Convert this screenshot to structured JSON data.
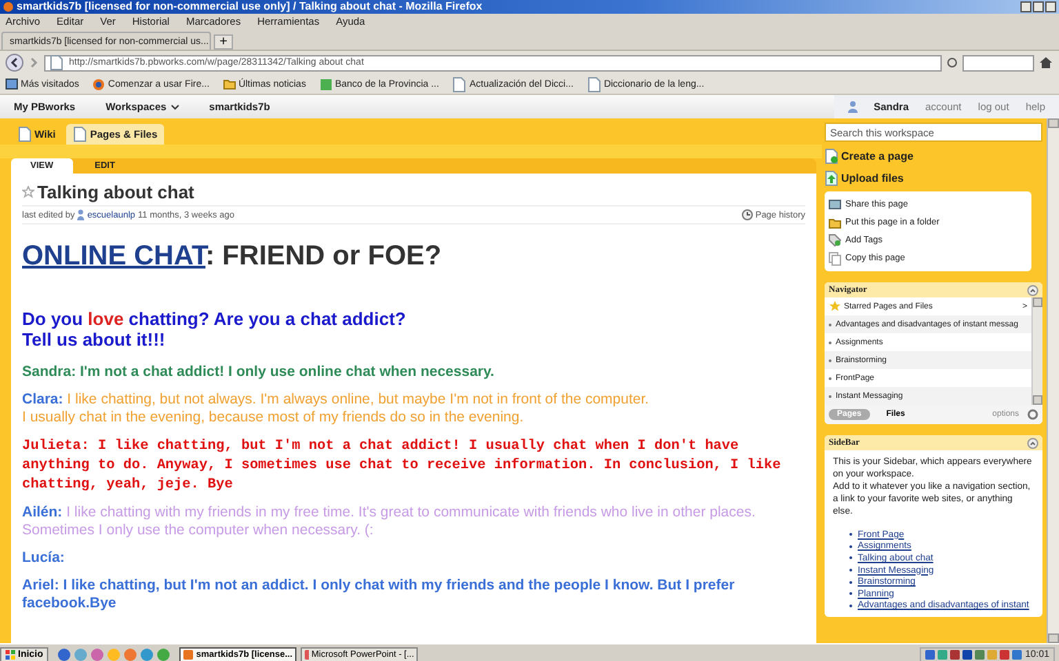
{
  "browser": {
    "title": "smartkids7b [licensed for non-commercial use only] / Talking about chat - Mozilla Firefox",
    "menu": [
      "Archivo",
      "Editar",
      "Ver",
      "Historial",
      "Marcadores",
      "Herramientas",
      "Ayuda"
    ],
    "tabs": [
      {
        "label": "smartkids7b [licensed for non-commercial us...",
        "selected": true
      }
    ],
    "new_tab": "+",
    "url": "http://smartkids7b.pbworks.com/w/page/28311342/Talking about chat",
    "bookmarks": [
      {
        "label": "Más visitados",
        "kind": "special"
      },
      {
        "label": "Comenzar a usar Fire...",
        "kind": "browser"
      },
      {
        "label": "Últimas noticias",
        "kind": "folder"
      },
      {
        "label": "Banco de la Provincia ...",
        "kind": "app"
      },
      {
        "label": "Actualización del Dicci...",
        "kind": "page"
      },
      {
        "label": "Diccionario de la leng...",
        "kind": "page"
      }
    ]
  },
  "pbworks_bar": {
    "items": [
      {
        "label": "My PBworks",
        "dropdown": false
      },
      {
        "label": "Workspaces",
        "dropdown": true
      },
      {
        "label": "smartkids7b",
        "dropdown": false
      }
    ],
    "user": "Sandra",
    "links": [
      "account",
      "log out",
      "help"
    ]
  },
  "wiki_tabs": [
    {
      "label": "Wiki",
      "selected": false
    },
    {
      "label": "Pages & Files",
      "selected": true
    }
  ],
  "view_tabs": [
    {
      "label": "VIEW",
      "selected": true
    },
    {
      "label": "EDIT",
      "selected": false
    }
  ],
  "page": {
    "title": "Talking about chat",
    "meta": {
      "prefix": "last edited by",
      "user": "escuelaunlp",
      "time": "11 months, 3 weeks ago"
    },
    "history": "Page history",
    "heading": [
      {
        "text": "ONLINE CHAT",
        "kind": "link"
      },
      {
        "text": ": FRIEND or FOE?",
        "kind": "plain"
      }
    ],
    "question": [
      [
        {
          "text": "Do you ",
          "color": "#1a1acc"
        },
        {
          "text": "love",
          "color": "#dd2222"
        },
        {
          "text": " chatting? Are you a chat addict?",
          "color": "#1a1acc"
        }
      ],
      [
        {
          "text": "Tell us about it!!!",
          "color": "#1a1acc"
        }
      ]
    ],
    "paragraphs": [
      {
        "lines": [
          [
            {
              "text": "Sandra: I'm not a chat addict! I only use online chat when necessary.",
              "color": "#2e8b57",
              "kind": "bold"
            }
          ]
        ]
      },
      {
        "lines": [
          [
            {
              "text": "Clara:",
              "color": "#3a6fd8",
              "kind": "bold"
            },
            {
              "text": " I like chatting, but not always. I'm always online, but maybe I'm not in front of the computer.",
              "color": "#f0a030",
              "kind": "plain"
            }
          ],
          [
            {
              "text": "I usually chat in the evening, because most of my friends do so in the evening.",
              "color": "#f0a030",
              "kind": "plain"
            }
          ]
        ]
      },
      {
        "lines": [
          [
            {
              "text": "Julieta: I like chatting, but I'm not a chat addict! I usually chat when I don't have anything to do. Anyway, I sometimes use chat to receive information. In conclusion, I like chatting, yeah, jeje. Bye",
              "color": "#e01010",
              "kind": "mono"
            }
          ]
        ]
      },
      {
        "lines": [
          [
            {
              "text": "Ailén:",
              "color": "#3a6fd8",
              "kind": "bold"
            },
            {
              "text": " I like chatting with my friends in my free time. It's great to communicate with friends who live in other places. Sometimes I only use the computer when necessary. (:",
              "color": "#c79ae6",
              "kind": "plain"
            }
          ]
        ]
      },
      {
        "lines": [
          [
            {
              "text": "Lucía:",
              "color": "#3a6fd8",
              "kind": "bold"
            }
          ]
        ]
      },
      {
        "lines": [
          [
            {
              "text": "Ariel: I like chatting, but I'm not an addict. I only chat with my friends and the people I know. But I prefer facebook.Bye",
              "color": "#3a6fd8",
              "kind": "bold"
            }
          ]
        ]
      }
    ]
  },
  "sidebar": {
    "search": {
      "placeholder": "Search this workspace"
    },
    "actions": [
      {
        "label": "Create a page",
        "kind": "create"
      },
      {
        "label": "Upload files",
        "kind": "upload"
      }
    ],
    "page_tools": [
      {
        "label": "Share this page",
        "kind": "share"
      },
      {
        "label": "Put this page in a folder",
        "kind": "folder"
      },
      {
        "label": "Add Tags",
        "kind": "tags"
      },
      {
        "label": "Copy this page",
        "kind": "copy"
      }
    ],
    "navigator": {
      "title": "Navigator",
      "starred": "Starred Pages and Files",
      "chevron": ">",
      "items": [
        "Advantages and disadvantages of instant messag",
        "Assignments",
        "Brainstorming",
        "FrontPage",
        "Instant Messaging"
      ],
      "tabs": [
        {
          "label": "Pages",
          "selected": true
        },
        {
          "label": "Files",
          "selected": false
        }
      ],
      "options": "options"
    },
    "sidebar_box": {
      "title": "SideBar",
      "paragraphs": [
        "This is your Sidebar, which appears everywhere on your workspace.",
        "Add to it whatever you like a navigation section, a link to your favorite web sites, or anything else."
      ],
      "links": [
        "Front Page",
        "Assignments",
        "Talking about chat",
        "Instant Messaging",
        "Brainstorming",
        "Planning",
        "Advantages and disadvantages of instant"
      ]
    }
  },
  "taskbar": {
    "start": "Inicio",
    "tasks": [
      {
        "label": "smartkids7b [license...",
        "selected": true
      },
      {
        "label": "Microsoft PowerPoint - [...",
        "selected": false
      }
    ],
    "clock": "10:01"
  }
}
